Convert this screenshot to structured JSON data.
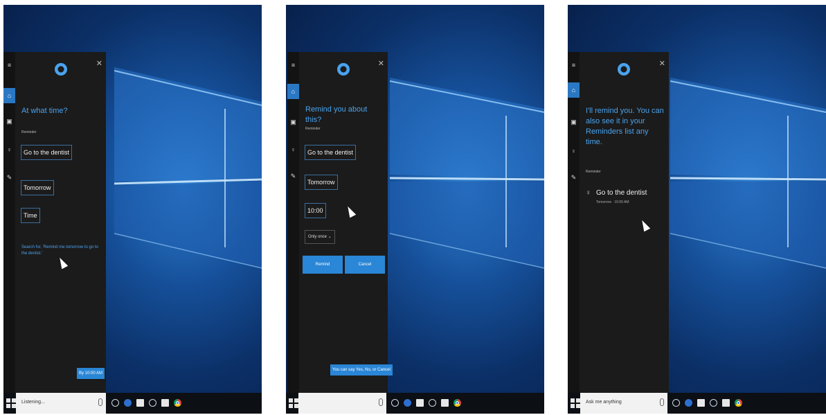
{
  "shots": [
    {
      "question": "At what time?",
      "section_label": "Reminder",
      "fields": [
        "Go to the dentist",
        "Tomorrow",
        "Time"
      ],
      "hint": "Search for, 'Remind me tomorrow to go to the dentist.'",
      "pill": "By 10:00 AM",
      "search_text": "Listening..."
    },
    {
      "question": "Remind you about this?",
      "section_label": "Reminder",
      "fields": [
        "Go to the dentist",
        "Tomorrow",
        "10:00"
      ],
      "repeat": "Only once",
      "remind_button": "Remind",
      "cancel_button": "Cancel",
      "pill": "You can say Yes, No, or Cancel",
      "search_text": ""
    },
    {
      "question": "I'll remind you. You can also see it in your Reminders list any time.",
      "section_label": "Reminder",
      "reminder_title": "Go to the dentist",
      "reminder_sub": "Tomorrow · 10:00 AM",
      "search_text": "Ask me anything"
    }
  ],
  "icons": {
    "rail": [
      "hamburger-icon",
      "home-icon",
      "notebook-icon",
      "lightbulb-icon",
      "feedback-icon"
    ],
    "taskbar": [
      "windows-start-icon",
      "task-view-icon",
      "edge-icon",
      "folder-icon",
      "store-icon",
      "chrome-icon"
    ]
  },
  "colors": {
    "accent": "#2a86d6",
    "panel": "#1b1b1b",
    "cortana_blue": "#4aa3ee"
  }
}
